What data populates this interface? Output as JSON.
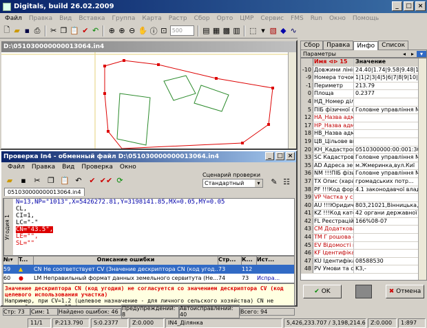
{
  "app": {
    "title": "Digitals, build 26.02.2009"
  },
  "menu": [
    "Файл",
    "Правка",
    "Вид",
    "Вставка",
    "Группа",
    "Карта",
    "Растр",
    "Сбор",
    "Орто",
    "ЦМР",
    "Сервис",
    "FMS",
    "Run",
    "Окно",
    "Помощь"
  ],
  "toolbar": {
    "scale_value": "500"
  },
  "map_window": {
    "title": "D:\\051030000000013064.in4"
  },
  "check_window": {
    "title": "Проверка In4 - обменный файл D:\\051030000000013064.in4",
    "menu": [
      "Файл",
      "Правка",
      "Вид",
      "Проверка",
      "Окно"
    ],
    "scenario_label": "Сценарий проверки",
    "scenario_value": "Стандартный",
    "doc_tab": "051030000000013064.in4",
    "side_label": "Угодия 1",
    "code_lines": [
      "N=13,NP=\"1013\",X=5426272.81,Y=3198141.85,MX=0.05,MY=0.05",
      "CL,",
      "CI=1,",
      "LC=\"-\"",
      "CN=\"43.5\",",
      "LE=\"\",",
      "SL=\"\""
    ],
    "errors_headers": [
      "№▾",
      "T...",
      "Описание ошибки",
      "Стр...",
      "К...",
      "Ист..."
    ],
    "errors": [
      {
        "num": "59",
        "desc": "CN Не соответствует CV (Значение дескриптора CN (код угод...",
        "line": "73",
        "col": "112",
        "src": ""
      },
      {
        "num": "60",
        "desc": "LM Неправильный формат данных земельного сервитута (Не...",
        "line": "74",
        "col": "73",
        "src": "Испра..."
      }
    ],
    "message_red": "Значение дескриптора CN (код угодия) не согласуется со значением дескриптора CV (код целевого использования участка)",
    "message_normal": "Например, при CV=1.2 (целевое назначение - для личного сельского хозяйства) CN не может быть равным 37 (код угодия - промышленные земли). Проверьте",
    "status": {
      "line": "Стр: 73",
      "col": "Сим: 1",
      "found": "Найдено ошибок: 46",
      "warnings": "Предупреждений: 8",
      "auto": "Автоисправлений: 40",
      "total": "Всего: 94"
    }
  },
  "right_panel": {
    "tabs": [
      "Сбор",
      "Правка",
      "Инфо",
      "Список"
    ],
    "params_label": "Параметры",
    "headers": [
      "Имя ⊲⊳ 15",
      "Значение"
    ],
    "rows": [
      {
        "n": "-10",
        "name": "Довжини ліній",
        "val": "24.40|1.74|9.58|9.48|1.51|2",
        "red": false
      },
      {
        "n": "-9",
        "name": "Номера точок",
        "val": "1|1|2|3|4|5|6|7|8|9|10|11|12|1",
        "red": false
      },
      {
        "n": "-1",
        "name": "Периметр",
        "val": "213.79",
        "red": false
      },
      {
        "n": "0",
        "name": "Площа",
        "val": "0.2377",
        "red": false
      },
      {
        "n": "4",
        "name": "НД_Номер діля",
        "val": "",
        "red": false
      },
      {
        "n": "5",
        "name": "ПІБ фізичної о",
        "val": "Головне управління М",
        "red": false
      },
      {
        "n": "12",
        "name": "НА_Назва адмі",
        "val": "",
        "red": true
      },
      {
        "n": "17",
        "name": "НР_Назва адмі",
        "val": "",
        "red": true
      },
      {
        "n": "18",
        "name": "НВ_Назва адмі",
        "val": "",
        "red": false
      },
      {
        "n": "19",
        "name": "ЦВ_Цільове вик",
        "val": "",
        "red": false
      },
      {
        "n": "20",
        "name": "КН_Кадастрови",
        "val": "0510300000:00:001:3064",
        "red": false
      },
      {
        "n": "33",
        "name": "SC Кадастровий",
        "val": "Головне управління М",
        "red": false
      },
      {
        "n": "35",
        "name": "AD Адреса зем",
        "val": "м.Жмеринка,вул.Киї",
        "red": false
      },
      {
        "n": "36",
        "name": "NM !!!ПІБ фізич",
        "val": "Головне управління М",
        "red": false
      },
      {
        "n": "37",
        "name": "TX Опис (харак",
        "val": "громадських потр...",
        "red": false
      },
      {
        "n": "38",
        "name": "PF !!!Код форм",
        "val": "4.1 законодавчої влад",
        "red": false
      },
      {
        "n": "39",
        "name": "VP Частка у спі",
        "val": "",
        "red": true
      },
      {
        "n": "40",
        "name": "AU !!!Юридичне",
        "val": "803,21021,Вінницька,об",
        "red": false
      },
      {
        "n": "41",
        "name": "KZ !!!Код катего",
        "val": "42 органи державної",
        "red": false
      },
      {
        "n": "42",
        "name": "FL Реєстраційн",
        "val": "166%08-07",
        "red": false
      },
      {
        "n": "43",
        "name": "СМ Додаткова",
        "val": "",
        "red": true
      },
      {
        "n": "44",
        "name": "ТМ Г рошова оц",
        "val": "",
        "red": true
      },
      {
        "n": "45",
        "name": "EV Відомості пр",
        "val": "",
        "red": true
      },
      {
        "n": "46",
        "name": "KF Ідентифікац",
        "val": "",
        "red": true
      },
      {
        "n": "47",
        "name": "KU Ідентифікац",
        "val": "08588530",
        "red": false
      },
      {
        "n": "48",
        "name": "PV Умови та сі",
        "val": "K3,-",
        "red": false
      }
    ],
    "ok_label": "OK",
    "cancel_label": "Отмена"
  },
  "status": {
    "page": "11/1",
    "perimeter": "P:213.790",
    "area": "S:0.2377",
    "z": "Z:0.000",
    "layer": "IN4_Ділянка",
    "coords": "5,426,233.707 / 3,198,214.657",
    "z2": "Z:0.000",
    "scale": "1:897"
  }
}
